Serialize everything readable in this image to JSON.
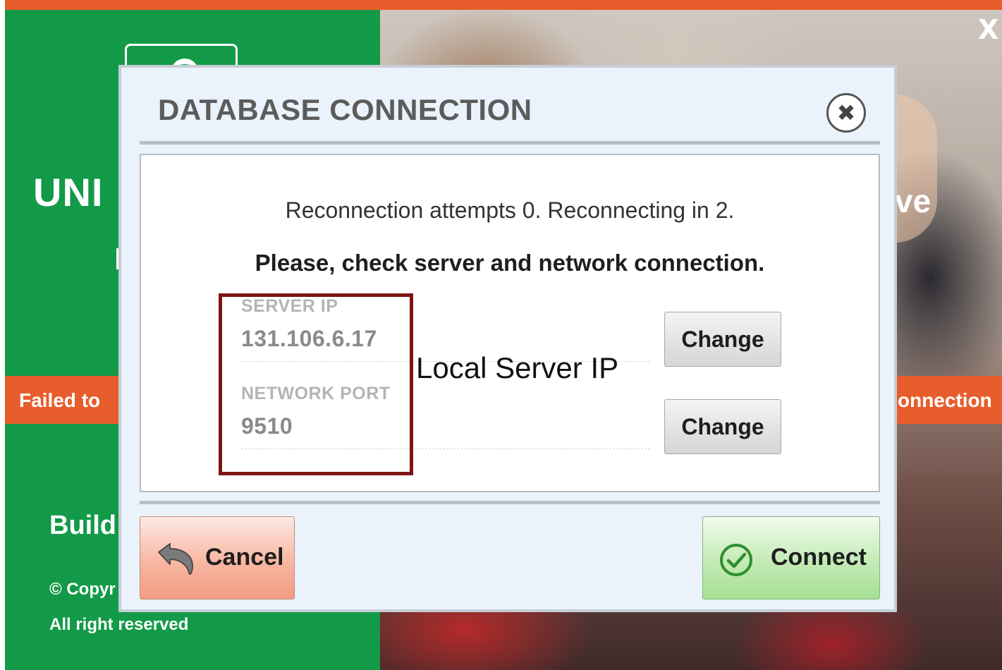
{
  "app": {
    "close_label": "X",
    "heading_left": "UNI",
    "heading_right": "ve",
    "error_left": "Failed to",
    "error_right": "onnection",
    "build_label": "Build",
    "copyright": "© Copyr",
    "rights": "All right reserved"
  },
  "dialog": {
    "title": "DATABASE CONNECTION",
    "close_icon": "close-circle-icon",
    "status_message": "Reconnection attempts 0. Reconnecting in 2.",
    "check_message": "Please, check server and network connection.",
    "fields": [
      {
        "label": "SERVER IP",
        "value": "131.106.6.17",
        "button": "Change"
      },
      {
        "label": "NETWORK PORT",
        "value": "9510",
        "button": "Change"
      }
    ],
    "annotation": "Local Server IP",
    "cancel_label": "Cancel",
    "cancel_icon": "undo-arrow-icon",
    "connect_label": "Connect",
    "connect_icon": "check-circle-icon"
  },
  "colors": {
    "accent_orange": "#e85d2c",
    "brand_green": "#139a48",
    "annotation_border": "#7d1414"
  }
}
